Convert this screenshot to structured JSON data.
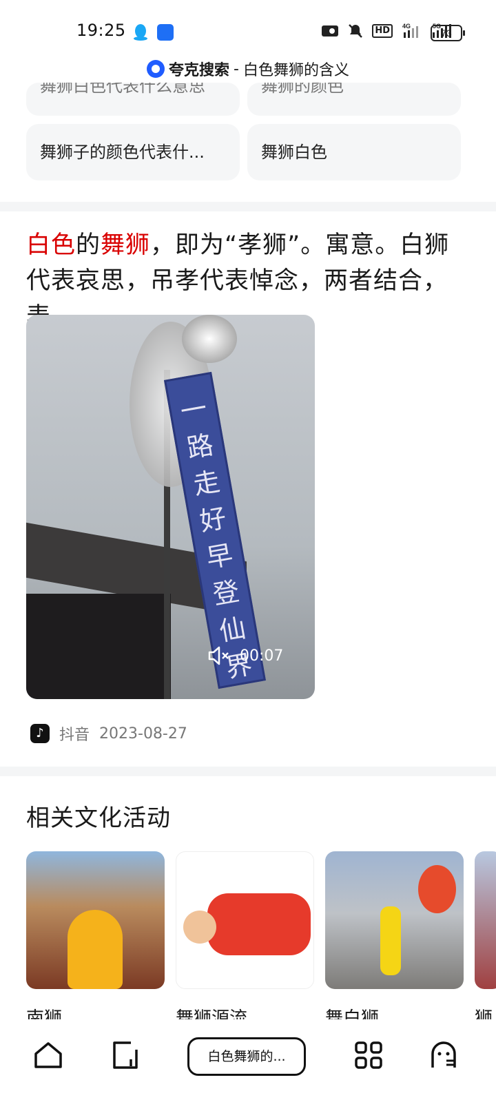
{
  "status_bar": {
    "time": "19:25",
    "battery": "73",
    "hd_label": "HD",
    "net1": "4G",
    "net2": "5G"
  },
  "header": {
    "brand": "夸克搜索",
    "separator": "-",
    "query": "白色舞狮的含义"
  },
  "suggestions": [
    {
      "label": "舞狮白色代表什么意思"
    },
    {
      "label": "舞狮的颜色"
    },
    {
      "label": "舞狮子的颜色代表什..."
    },
    {
      "label": "舞狮白色"
    }
  ],
  "answer": {
    "hl1": "白色",
    "t1": "的",
    "hl2": "舞狮",
    "t2": "，即为“孝狮”。寓意。白狮代表哀思，吊孝代表悼念，两者结合，表..."
  },
  "video": {
    "duration": "00:07",
    "banner_text": [
      "一",
      "路",
      "走",
      "好",
      "早",
      "登",
      "仙",
      "界"
    ]
  },
  "source": {
    "icon": "douyin-icon",
    "name": "抖音",
    "date": "2023-08-27"
  },
  "related": {
    "title": "相关文化活动",
    "items": [
      {
        "label": "南狮"
      },
      {
        "label": "舞狮源流"
      },
      {
        "label": "舞白狮"
      },
      {
        "label": "狮"
      }
    ]
  },
  "bottom_nav": {
    "home_icon": "home-icon",
    "tabs_count": "1",
    "current_tab": "白色舞狮的...",
    "apps_icon": "apps-grid-icon",
    "profile_icon": "ghost-icon"
  },
  "colors": {
    "highlight": "#d90000",
    "brand_blue": "#1f5cff"
  }
}
